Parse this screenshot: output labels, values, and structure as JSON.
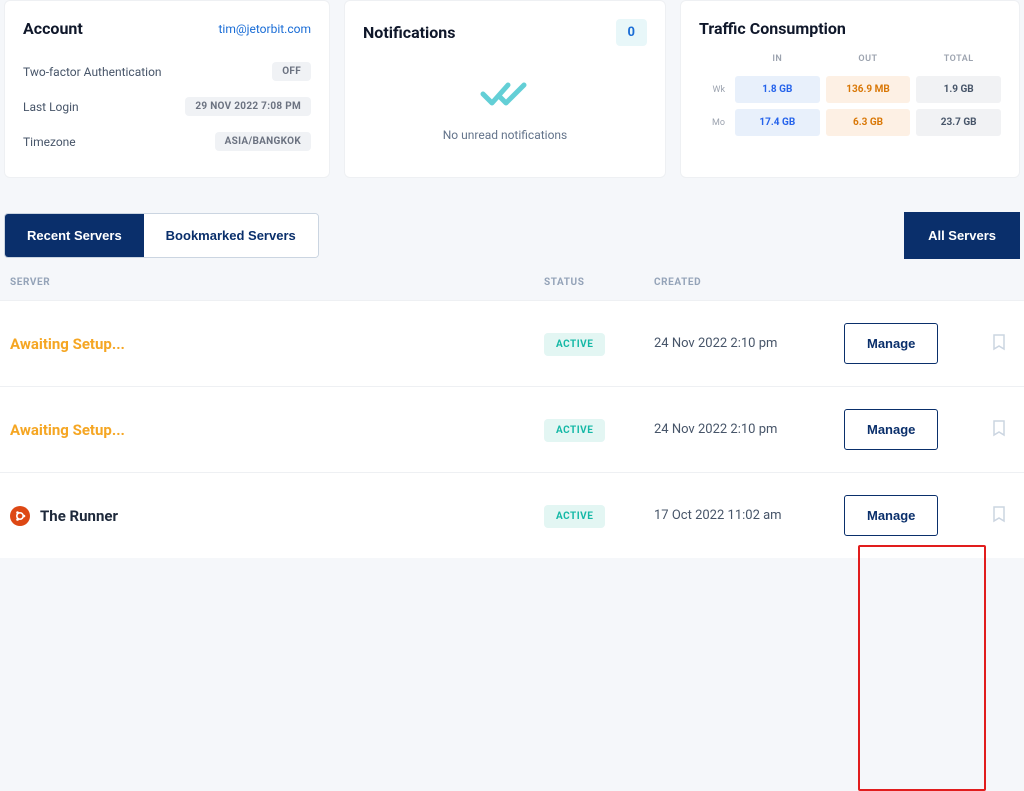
{
  "account": {
    "title": "Account",
    "email": "tim@jetorbit.com",
    "rows": {
      "twofa_label": "Two-factor Authentication",
      "twofa_value": "OFF",
      "lastlogin_label": "Last Login",
      "lastlogin_value": "29 NOV 2022 7:08 PM",
      "tz_label": "Timezone",
      "tz_value": "ASIA/BANGKOK"
    }
  },
  "notifications": {
    "title": "Notifications",
    "count": "0",
    "empty_text": "No unread notifications"
  },
  "traffic": {
    "title": "Traffic Consumption",
    "col_in": "IN",
    "col_out": "OUT",
    "col_total": "TOTAL",
    "row_wk_label": "Wk",
    "row_mo_label": "Mo",
    "wk_in": "1.8 GB",
    "wk_out": "136.9 MB",
    "wk_total": "1.9 GB",
    "mo_in": "17.4 GB",
    "mo_out": "6.3 GB",
    "mo_total": "23.7 GB"
  },
  "tabs": {
    "recent": "Recent Servers",
    "bookmarked": "Bookmarked Servers",
    "all": "All Servers"
  },
  "list": {
    "col_server": "SERVER",
    "col_status": "STATUS",
    "col_created": "CREATED",
    "manage": "Manage",
    "rows": [
      {
        "name": "Awaiting Setup...",
        "status": "ACTIVE",
        "created": "24 Nov 2022 2:10 pm",
        "await": true,
        "os": false
      },
      {
        "name": "Awaiting Setup...",
        "status": "ACTIVE",
        "created": "24 Nov 2022 2:10 pm",
        "await": true,
        "os": false
      },
      {
        "name": "The Runner",
        "status": "ACTIVE",
        "created": "17 Oct 2022 11:02 am",
        "await": false,
        "os": true
      }
    ]
  }
}
